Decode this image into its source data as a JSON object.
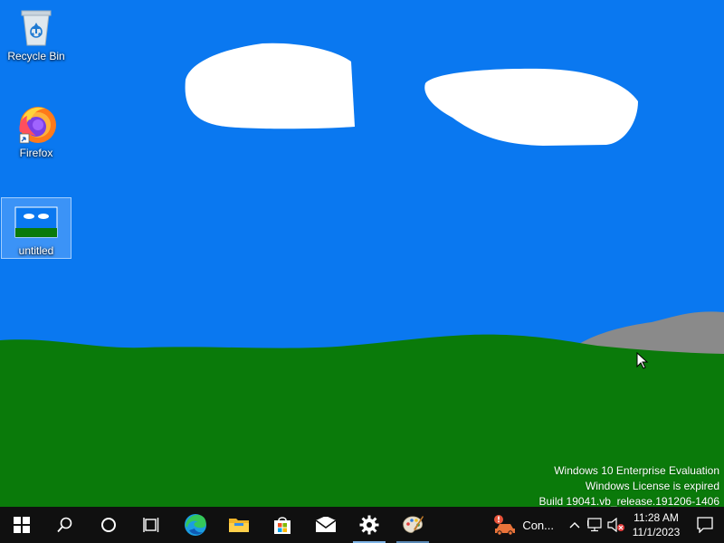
{
  "desktop": {
    "icons": [
      {
        "name": "recycle-bin",
        "label": "Recycle Bin"
      },
      {
        "name": "firefox",
        "label": "Firefox"
      },
      {
        "name": "untitled",
        "label": "untitled",
        "selected": true
      }
    ],
    "watermark": {
      "line1": "Windows 10 Enterprise Evaluation",
      "line2": "Windows License is expired",
      "line3": "Build 19041.vb_release.191206-1406"
    }
  },
  "taskbar": {
    "buttons": [
      {
        "name": "start",
        "icon": "windows-logo-icon"
      },
      {
        "name": "search",
        "icon": "search-icon"
      },
      {
        "name": "cortana",
        "icon": "cortana-circle-icon"
      },
      {
        "name": "task-view",
        "icon": "task-view-icon"
      },
      {
        "name": "edge",
        "icon": "edge-icon"
      },
      {
        "name": "file-explorer",
        "icon": "folder-icon"
      },
      {
        "name": "store",
        "icon": "store-bag-icon"
      },
      {
        "name": "mail",
        "icon": "mail-icon"
      },
      {
        "name": "settings",
        "icon": "gear-icon",
        "running": true
      },
      {
        "name": "paint",
        "icon": "paint-palette-icon",
        "running": true
      }
    ],
    "tray": {
      "connection_label": "Con...",
      "clock_time": "11:28 AM",
      "clock_date": "11/1/2023"
    }
  },
  "colors": {
    "sky": "#0a78f0",
    "grass": "#0a7a0a",
    "cloud": "#ffffff",
    "rock": "#8a8a8a",
    "taskbar": "#101010",
    "accent": "#7fb4e6"
  }
}
